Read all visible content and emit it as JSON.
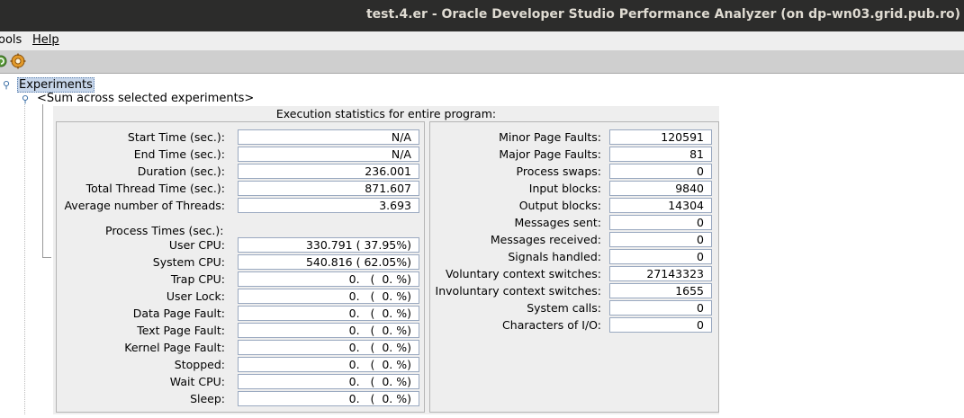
{
  "window": {
    "title": "test.4.er  -  Oracle Developer Studio Performance Analyzer (on dp-wn03.grid.pub.ro)"
  },
  "menubar": {
    "tools_partial": "ools",
    "help": "Help"
  },
  "toolbar": {
    "icons": [
      "refresh-icon",
      "settings-gear-icon"
    ]
  },
  "tree": {
    "root_label": "Experiments",
    "child_label": "<Sum across selected experiments>"
  },
  "stats": {
    "title": "Execution statistics for entire program:",
    "left_top": [
      {
        "label": "Start Time (sec.):",
        "value": "N/A"
      },
      {
        "label": "End Time (sec.):",
        "value": "N/A"
      },
      {
        "label": "Duration (sec.):",
        "value": "236.001"
      },
      {
        "label": "Total Thread Time (sec.):",
        "value": "871.607"
      },
      {
        "label": "Average number of Threads:",
        "value": "3.693"
      }
    ],
    "process_times_label": "Process Times (sec.):",
    "process_times": [
      {
        "label": "User CPU:",
        "value": "330.791 ( 37.95%)"
      },
      {
        "label": "System CPU:",
        "value": "540.816 ( 62.05%)"
      },
      {
        "label": "Trap CPU:",
        "value": "0.   (  0. %)"
      },
      {
        "label": "User Lock:",
        "value": "0.   (  0. %)"
      },
      {
        "label": "Data Page Fault:",
        "value": "0.   (  0. %)"
      },
      {
        "label": "Text Page Fault:",
        "value": "0.   (  0. %)"
      },
      {
        "label": "Kernel Page Fault:",
        "value": "0.   (  0. %)"
      },
      {
        "label": "Stopped:",
        "value": "0.   (  0. %)"
      },
      {
        "label": "Wait CPU:",
        "value": "0.   (  0. %)"
      },
      {
        "label": "Sleep:",
        "value": "0.   (  0. %)"
      }
    ],
    "right": [
      {
        "label": "Minor Page Faults:",
        "value": "120591"
      },
      {
        "label": "Major Page Faults:",
        "value": "81"
      },
      {
        "label": "Process swaps:",
        "value": "0"
      },
      {
        "label": "Input blocks:",
        "value": "9840"
      },
      {
        "label": "Output blocks:",
        "value": "14304"
      },
      {
        "label": "Messages sent:",
        "value": "0"
      },
      {
        "label": "Messages received:",
        "value": "0"
      },
      {
        "label": "Signals handled:",
        "value": "0"
      },
      {
        "label": "Voluntary context switches:",
        "value": "27143323"
      },
      {
        "label": "Involuntary context switches:",
        "value": "1655"
      },
      {
        "label": "System calls:",
        "value": "0"
      },
      {
        "label": "Characters of I/O:",
        "value": "0"
      }
    ]
  }
}
